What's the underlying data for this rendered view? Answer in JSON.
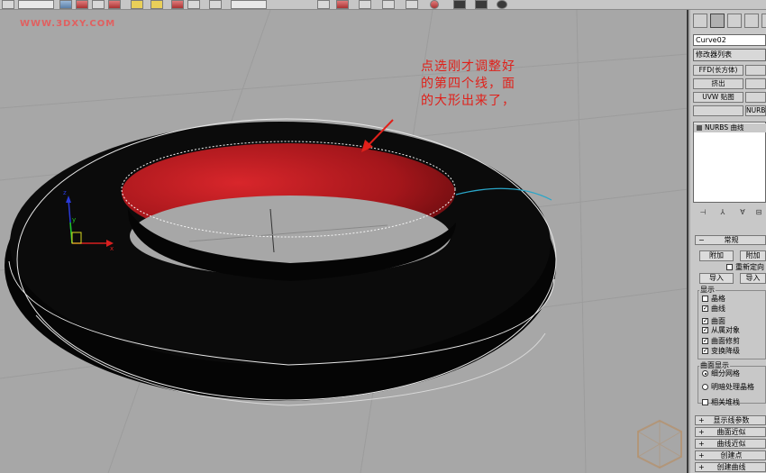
{
  "watermark": "WWW.3DXY.COM",
  "annotation": {
    "line1": "点选刚才调整好",
    "line2": "的第四个线，面",
    "line3": "的大形出来了，"
  },
  "axis_labels": {
    "x": "x",
    "y": "y",
    "z": "z"
  },
  "panel": {
    "object_name": "Curve02",
    "modifier_list": "修改器列表",
    "mod_buttons": [
      "FFD(长方体)",
      "",
      "挤出",
      "",
      "UVW 贴图",
      "",
      "",
      "NURBS"
    ],
    "stack_item": "NURBS 曲线",
    "rollout_general": "常规",
    "attach": "附加",
    "attach_multiple": "附加",
    "reorient": "重新定向",
    "import": "导入",
    "import_multiple": "导入",
    "display_group": "显示",
    "display_items": [
      {
        "label": "晶格",
        "checked": false
      },
      {
        "label": "曲线",
        "checked": true
      },
      {
        "label": "曲面",
        "checked": true
      },
      {
        "label": "从属对象",
        "checked": true
      },
      {
        "label": "曲面修剪",
        "checked": true
      },
      {
        "label": "变换降级",
        "checked": true
      }
    ],
    "surface_display_group": "曲面显示",
    "surface_display_options": [
      {
        "label": "细分网格",
        "selected": true
      },
      {
        "label": "明暗处理晶格",
        "selected": false
      }
    ],
    "relational_stack": "相关堆栈",
    "rollouts_collapsed": [
      "显示线参数",
      "曲面近似",
      "曲线近似",
      "创建点",
      "创建曲线"
    ]
  },
  "colors": {
    "viewport_bg": "#a7a7a7",
    "torus": "#050505",
    "inner_red": "#c41f24",
    "annotation_red": "#e0201a",
    "selected_curve": "#2aa6c8",
    "panel_bg": "#c8c8c8"
  }
}
